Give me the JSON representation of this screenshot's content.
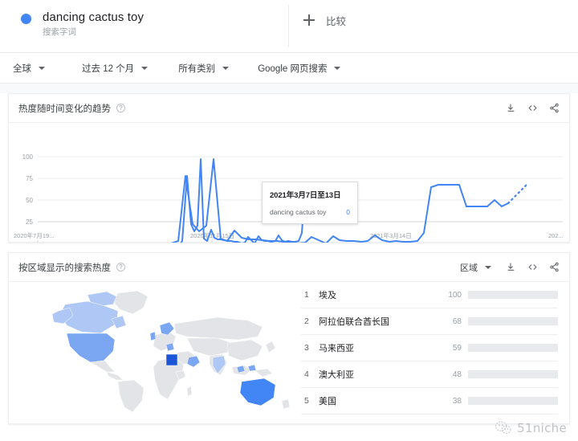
{
  "term": {
    "name": "dancing cactus toy",
    "subtitle": "搜索字词",
    "dot_color": "#4285f4"
  },
  "compare": {
    "label": "比较",
    "icon": "plus-icon"
  },
  "filters": [
    {
      "label": "全球"
    },
    {
      "label": "过去 12 个月"
    },
    {
      "label": "所有类别"
    },
    {
      "label": "Google 网页搜索"
    }
  ],
  "interest_over_time": {
    "title": "热度随时间变化的趋势",
    "help": "?",
    "tools": [
      "download-icon",
      "embed-icon",
      "share-icon"
    ],
    "tooltip": {
      "date": "2021年3月7日至13日",
      "term": "dancing cactus toy",
      "value": "0"
    }
  },
  "interest_by_region": {
    "title": "按区域显示的搜索热度",
    "help": "?",
    "scope_label": "区域",
    "tools": [
      "download-icon",
      "embed-icon",
      "share-icon"
    ],
    "rows": [
      {
        "rank": "1",
        "name": "埃及",
        "value": "100",
        "pct": 100
      },
      {
        "rank": "2",
        "name": "阿拉伯联合酋长国",
        "value": "68",
        "pct": 68
      },
      {
        "rank": "3",
        "name": "马来西亚",
        "value": "59",
        "pct": 59
      },
      {
        "rank": "4",
        "name": "澳大利亚",
        "value": "48",
        "pct": 48
      },
      {
        "rank": "5",
        "name": "美国",
        "value": "38",
        "pct": 38
      }
    ]
  },
  "watermark": {
    "text": "51niche"
  },
  "chart_data": {
    "type": "line",
    "title": "热度随时间变化的趋势",
    "xlabel": "",
    "ylabel": "",
    "ylim": [
      0,
      100
    ],
    "yticks": [
      "25",
      "50",
      "75",
      "100"
    ],
    "ytick_values": [
      25,
      50,
      75,
      100
    ],
    "xticks": [
      "2020年7月19...",
      "2020年11月15日",
      "2021年3月14日",
      "202..."
    ],
    "xtick_positions": [
      0.0,
      0.335,
      0.665,
      0.985
    ],
    "grid": true,
    "legend": false,
    "line_color": "#4285f4",
    "series": [
      {
        "name": "dancing cactus toy",
        "values": [
          0,
          0,
          0,
          0,
          0,
          0,
          0,
          0,
          0,
          0,
          0,
          0,
          0,
          0,
          0,
          0,
          0,
          0,
          0,
          0,
          0,
          0,
          0,
          0,
          0,
          0,
          0,
          0,
          0,
          3,
          78,
          22,
          14,
          20,
          97,
          5,
          2,
          16,
          6,
          5,
          5,
          4,
          3,
          3,
          2,
          2,
          0,
          1,
          7,
          4,
          0,
          8,
          4,
          3,
          3,
          2,
          3,
          9,
          4,
          2,
          3,
          2,
          2,
          3,
          12,
          70,
          70,
          34,
          34,
          34,
          34,
          45,
          34,
          41,
          58
        ]
      }
    ],
    "forecast_dashed_tail": true,
    "annotation": {
      "date": "2021年3月7日至13日",
      "series": "dancing cactus toy",
      "value": 0
    }
  },
  "map_data": {
    "type": "choropleth",
    "scale_colors": [
      "#e8eaed",
      "#aec7f5",
      "#7aa6f2",
      "#4285f4",
      "#1a56d6"
    ],
    "highlighted": [
      {
        "region": "埃及",
        "level": 4
      },
      {
        "region": "阿拉伯联合酋长国",
        "level": 3
      },
      {
        "region": "马来西亚",
        "level": 2
      },
      {
        "region": "澳大利亚",
        "level": 3
      },
      {
        "region": "美国",
        "level": 3
      },
      {
        "region": "加拿大",
        "level": 2
      },
      {
        "region": "英国",
        "level": 2
      }
    ]
  }
}
